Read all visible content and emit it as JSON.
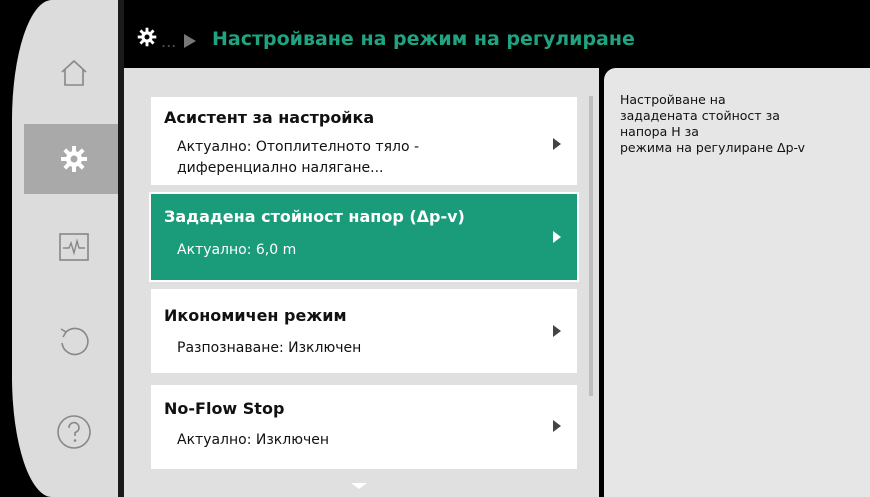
{
  "header": {
    "ellipsis": "...",
    "title": "Настройване на режим на регулиране"
  },
  "sidebar": {
    "items": [
      {
        "icon": "home-icon"
      },
      {
        "icon": "gear-icon",
        "active": true
      },
      {
        "icon": "diagnostics-icon"
      },
      {
        "icon": "restore-icon"
      },
      {
        "icon": "help-icon"
      }
    ]
  },
  "menu": [
    {
      "title": "Асистент за настройка",
      "sub": "Актуално: Отоплителното тяло - диференциално налягане..."
    },
    {
      "title": "Зададена стойност напор (Δp-v)",
      "sub": "Актуално: 6,0 m",
      "selected": true
    },
    {
      "title": "Икономичен режим",
      "sub": "Разпознаване: Изключен"
    },
    {
      "title": "No-Flow Stop",
      "sub": "Актуално: Изключен"
    }
  ],
  "info": {
    "text": "Настройване на\nзададената стойност за\nнапора Н за\nрежима на регулиране Δp-v"
  },
  "colors": {
    "accent": "#1a9c7b",
    "title": "#1fa381"
  }
}
